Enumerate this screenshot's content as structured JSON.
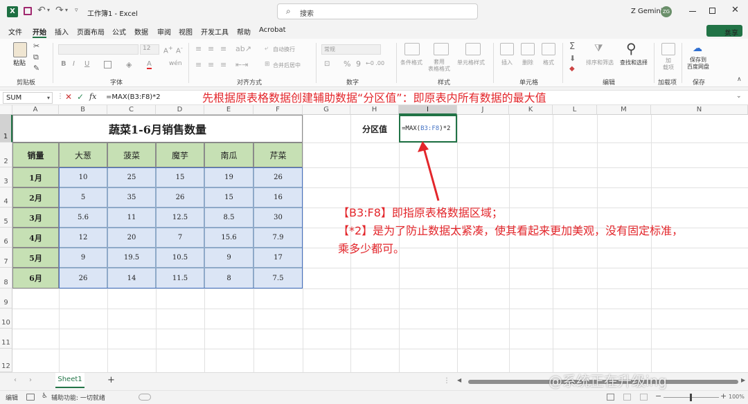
{
  "window": {
    "doc_title": "工作簿1 - Excel",
    "search_placeholder": "搜索",
    "user_name": "Z Gemini",
    "user_initials": "ZG"
  },
  "menu": [
    "文件",
    "开始",
    "插入",
    "页面布局",
    "公式",
    "数据",
    "审阅",
    "视图",
    "开发工具",
    "帮助",
    "Acrobat"
  ],
  "share_label": "共享",
  "ribbon": {
    "paste": "粘贴",
    "groups": [
      "剪贴板",
      "字体",
      "对齐方式",
      "数字",
      "样式",
      "单元格",
      "编辑",
      "加载项",
      "保存"
    ],
    "font_size": "12",
    "wrap_text": "自动换行",
    "merge_center": "合并后居中",
    "number_format": "常规",
    "cond_format": "条件格式",
    "table_format": "套用\n表格格式",
    "cell_styles": "单元格样式",
    "insert": "插入",
    "delete": "删除",
    "format": "格式",
    "sort_filter": "排序和筛选",
    "find_select": "查找和选择",
    "addins": "加\n载项",
    "save_to": "保存到\n百度网盘"
  },
  "formula_bar": {
    "name_box": "SUM",
    "formula": "=MAX(B3:F8)*2",
    "annotation": "先根据原表格数据创建辅助数据“分区值”：即原表内所有数据的最大值"
  },
  "columns": [
    "A",
    "B",
    "C",
    "D",
    "E",
    "F",
    "G",
    "H",
    "I",
    "J",
    "K",
    "L",
    "M",
    "N"
  ],
  "rows": [
    "1",
    "2",
    "3",
    "4",
    "5",
    "6",
    "7",
    "8",
    "9",
    "10",
    "11",
    "12"
  ],
  "table": {
    "title": "蔬菜1-6月销售数量",
    "corner": "销量",
    "headers": [
      "大葱",
      "菠菜",
      "魔芋",
      "南瓜",
      "芹菜"
    ],
    "rows": [
      {
        "label": "1月",
        "values": [
          "10",
          "25",
          "15",
          "19",
          "26"
        ]
      },
      {
        "label": "2月",
        "values": [
          "5",
          "35",
          "26",
          "15",
          "16"
        ]
      },
      {
        "label": "3月",
        "values": [
          "5.6",
          "11",
          "12.5",
          "8.5",
          "30"
        ]
      },
      {
        "label": "4月",
        "values": [
          "12",
          "20",
          "7",
          "15.6",
          "7.9"
        ]
      },
      {
        "label": "5月",
        "values": [
          "9",
          "19.5",
          "10.5",
          "9",
          "17"
        ]
      },
      {
        "label": "6月",
        "values": [
          "26",
          "14",
          "11.5",
          "8",
          "7.5"
        ]
      }
    ]
  },
  "partition": {
    "label": "分区值",
    "formula_prefix": "=MAX(",
    "formula_ref": "B3:F8",
    "formula_suffix": ")*2"
  },
  "note": {
    "line1": "【B3:F8】即指原表格数据区域；",
    "line2": "【*2】是为了防止数据太紧凑，使其看起来更加美观，没有固定标准，",
    "line3": "乘多少都可。"
  },
  "sheet_tab": "Sheet1",
  "status": {
    "mode": "编辑",
    "accessibility": "辅助功能: 一切就绪",
    "zoom": "100%"
  },
  "watermark": "@系统正在升级ing",
  "colors": {
    "header_green": "#c6e0b4",
    "value_blue": "#dbe5f5",
    "annotation_red": "#e3262b",
    "excel_green": "#217346"
  }
}
